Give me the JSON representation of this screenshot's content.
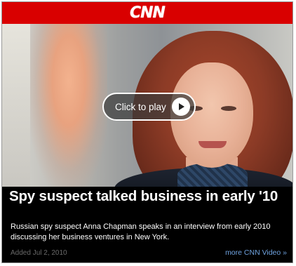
{
  "header": {
    "logo_text": "CNN",
    "brand_color": "#d90000"
  },
  "video": {
    "play_label": "Click to play",
    "play_icon": "play-icon"
  },
  "story": {
    "headline": "Spy suspect talked business in early '10",
    "description": "Russian spy suspect Anna Chapman speaks in an interview from early 2010 discussing her business ventures in New York.",
    "date": "Added Jul 2, 2010",
    "more_link": "more CNN Video »"
  },
  "colors": {
    "link": "#6fa3e0",
    "background": "#000000"
  }
}
